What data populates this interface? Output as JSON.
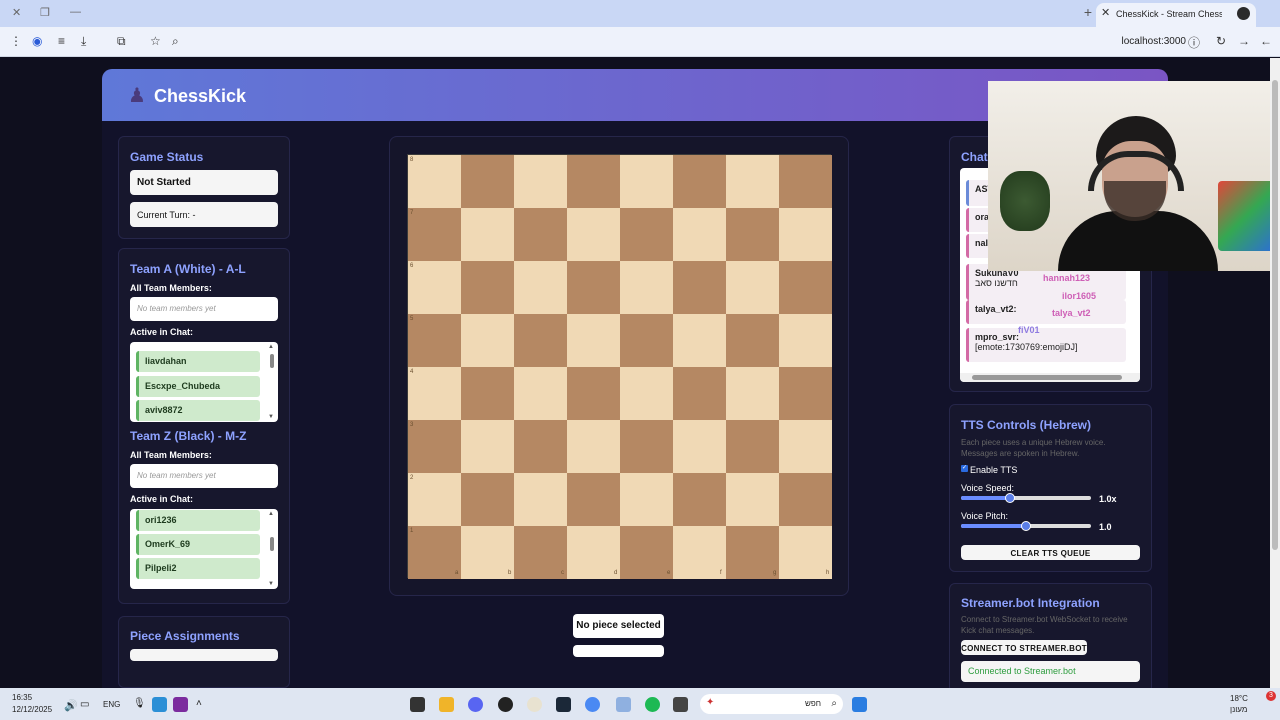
{
  "browser": {
    "tab_title": "ChessKick - Stream Chess Game",
    "url": "localhost:3000"
  },
  "app": {
    "title": "ChessKick",
    "logo_icon": "chess-pawn-icon"
  },
  "game_status": {
    "title": "Game Status",
    "status": "Not Started",
    "current_turn": "Current Turn: -"
  },
  "team_a": {
    "title": "Team A (White) - A-L",
    "all_members_label": "All Team Members:",
    "empty_text": "No team members yet",
    "active_label": "Active in Chat:",
    "active": [
      "liavdahan",
      "Escxpe_Chubeda",
      "aviv8872"
    ]
  },
  "team_z": {
    "title": "Team Z (Black) - M-Z",
    "all_members_label": "All Team Members:",
    "empty_text": "No team members yet",
    "active_label": "Active in Chat:",
    "active": [
      "ori1236",
      "OmerK_69",
      "Pilpeli2"
    ]
  },
  "piece_assignments": {
    "title": "Piece Assignments"
  },
  "board": {
    "ranks": [
      "8",
      "7",
      "6",
      "5",
      "4",
      "3",
      "2",
      "1"
    ],
    "files": [
      "a",
      "b",
      "c",
      "d",
      "e",
      "f",
      "g",
      "h"
    ],
    "light_color": "#f0d9b5",
    "dark_color": "#b58863"
  },
  "selection": {
    "label": "No piece selected"
  },
  "chat": {
    "title": "Chat",
    "messages": [
      {
        "user": "AST",
        "text": ""
      },
      {
        "user": "ora",
        "text": ""
      },
      {
        "user": "nal",
        "text": ""
      },
      {
        "user": "SukunaV0",
        "text": "חדשנו סאב"
      },
      {
        "user": "talya_vt2:",
        "text": ""
      },
      {
        "user": "mpro_svr:",
        "text": "[emote:1730769:emojiDJ]"
      }
    ],
    "overlay_names": [
      "hannah123",
      "ilor1605",
      "talya_vt2",
      "fiV01"
    ]
  },
  "tts": {
    "title": "TTS Controls (Hebrew)",
    "description": "Each piece uses a unique Hebrew voice. Messages are spoken in Hebrew.",
    "enable_label": "Enable TTS",
    "enabled": true,
    "speed_label": "Voice Speed:",
    "speed_value": "1.0x",
    "speed_fraction": 0.38,
    "pitch_label": "Voice Pitch:",
    "pitch_value": "1.0",
    "pitch_fraction": 0.5,
    "clear_button": "CLEAR TTS QUEUE"
  },
  "streamerbot": {
    "title": "Streamer.bot Integration",
    "description": "Connect to Streamer.bot WebSocket to receive Kick chat messages.",
    "connect_button": "CONNECT TO STREAMER.BOT",
    "status": "Connected to Streamer.bot",
    "status_color": "#2e9d3f"
  },
  "taskbar": {
    "time": "16:35",
    "date": "12/12/2025",
    "lang": "ENG",
    "search_placeholder": "חפש",
    "weather": "18°C",
    "weather_desc": "מעונן",
    "notifications": "3"
  }
}
